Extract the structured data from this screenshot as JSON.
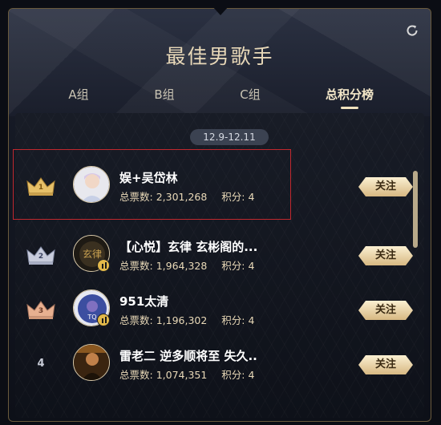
{
  "header": {
    "title": "最佳男歌手",
    "refresh_icon": "refresh-icon"
  },
  "tabs": [
    {
      "label": "A组",
      "active": false
    },
    {
      "label": "B组",
      "active": false
    },
    {
      "label": "C组",
      "active": false
    },
    {
      "label": "总积分榜",
      "active": true
    }
  ],
  "date_range": "12.9-12.11",
  "ranking": [
    {
      "rank": "1",
      "name": "娱+吴岱林",
      "votes_label": "总票数:",
      "votes": "2,301,268",
      "score_label": "积分:",
      "score": "4",
      "follow_label": "关注",
      "crown": "gold-crown-icon"
    },
    {
      "rank": "2",
      "name": "【心悦】玄律 玄彬阁的...",
      "votes_label": "总票数:",
      "votes": "1,964,328",
      "score_label": "积分:",
      "score": "4",
      "follow_label": "关注",
      "crown": "silver-crown-icon"
    },
    {
      "rank": "3",
      "name": "951太清",
      "votes_label": "总票数:",
      "votes": "1,196,302",
      "score_label": "积分:",
      "score": "4",
      "follow_label": "关注",
      "crown": "bronze-crown-icon"
    },
    {
      "rank": "4",
      "name": "雷老二 逆多顺将至 失久..",
      "votes_label": "总票数:",
      "votes": "1,074,351",
      "score_label": "积分:",
      "score": "4",
      "follow_label": "关注",
      "crown": ""
    }
  ],
  "colors": {
    "accent_gold": "#e9d9b8",
    "highlight_border": "#c0282e",
    "gold_crown": "#e6c068",
    "silver_crown": "#c8ccdc",
    "bronze_crown": "#e8b090"
  }
}
